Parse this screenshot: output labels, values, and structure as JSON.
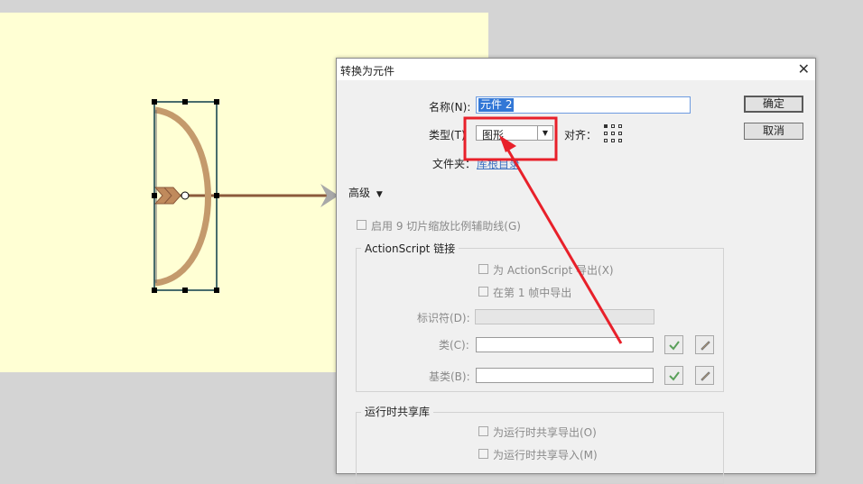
{
  "dialog": {
    "title": "转换为元件",
    "close_glyph": "✕",
    "name_label": "名称(N):",
    "name_value": "元件 2",
    "type_label": "类型(T)",
    "type_value": "图形",
    "type_arrow": "▼",
    "align_label": "对齐：",
    "folder_label": "文件夹：",
    "folder_value": "库根目录",
    "ok_label": "确定",
    "cancel_label": "取消",
    "advanced_label": "高级",
    "advanced_arrow": "▼",
    "enable_9slice_label": "启用 9 切片缩放比例辅助线(G)",
    "actionscript_group": {
      "title": "ActionScript 链接",
      "export_as_label": "为 ActionScript 导出(X)",
      "export_frame1_label": "在第 1 帧中导出",
      "identifier_label": "标识符(D):",
      "class_label": "类(C):",
      "base_class_label": "基类(B):"
    },
    "runtime_group": {
      "title": "运行时共享库",
      "export_runtime_label": "为运行时共享导出(O)",
      "import_runtime_label": "为运行时共享导入(M)"
    }
  },
  "colors": {
    "stage": "#ffffd4",
    "bow_wood": "#c49a6c",
    "arrow_shaft": "#8b5a3c",
    "selection": "#0b3b4a",
    "annotation": "#e8202a",
    "link": "#3a6fc0"
  },
  "icons": [
    "checkmark-icon",
    "pencil-icon",
    "dropdown-arrow-icon",
    "close-icon"
  ]
}
